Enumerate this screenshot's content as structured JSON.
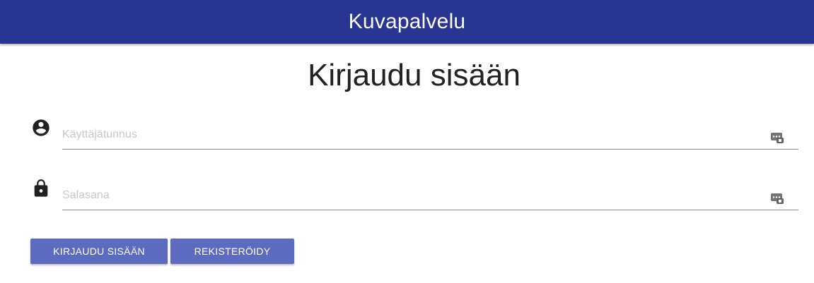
{
  "appbar": {
    "title": "Kuvapalvelu"
  },
  "page": {
    "title": "Kirjaudu sisään"
  },
  "form": {
    "username": {
      "placeholder": "Käyttäjätunnus",
      "value": ""
    },
    "password": {
      "placeholder": "Salasana",
      "value": ""
    }
  },
  "buttons": {
    "login_label": "KIRJAUDU SISÄÄN",
    "register_label": "REKISTERÖIDY"
  },
  "icons": {
    "user": "account-circle-icon",
    "lock": "lock-icon",
    "password_manager": "password-manager-icon"
  },
  "colors": {
    "appbar": "#283593",
    "button": "#5c6bc0"
  }
}
